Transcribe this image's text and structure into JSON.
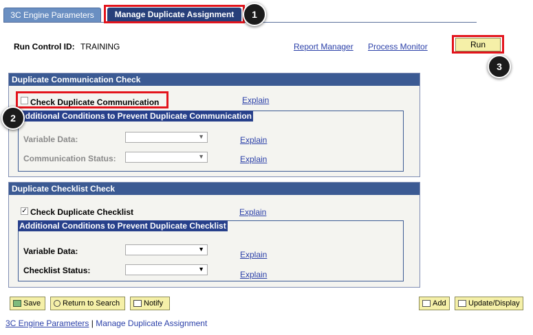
{
  "tabs": [
    {
      "label": "3C Engine Parameters"
    },
    {
      "label": "Manage Duplicate Assignment"
    }
  ],
  "callouts": [
    "1",
    "2",
    "3"
  ],
  "header": {
    "run_control_label": "Run Control ID:",
    "run_control_value": "TRAINING",
    "report_manager": "Report Manager",
    "process_monitor": "Process Monitor",
    "run_button": "Run"
  },
  "comm_group": {
    "title": "Duplicate Communication Check",
    "checkbox_label": "Check Duplicate Communication",
    "checked": false,
    "explain": "Explain",
    "inner_title": "Additional Conditions to Prevent Duplicate Communication",
    "fields": [
      {
        "label": "Variable Data:",
        "value": "",
        "explain": "Explain"
      },
      {
        "label": "Communication Status:",
        "value": "",
        "explain": "Explain"
      }
    ]
  },
  "checklist_group": {
    "title": "Duplicate Checklist Check",
    "checkbox_label": "Check Duplicate Checklist",
    "checked": true,
    "explain": "Explain",
    "inner_title": "Additional Conditions to Prevent Duplicate Checklist",
    "fields": [
      {
        "label": "Variable Data:",
        "value": "",
        "explain": "Explain"
      },
      {
        "label": "Checklist Status:",
        "value": "",
        "explain": "Explain"
      }
    ]
  },
  "toolbar": {
    "save": "Save",
    "return_to_search": "Return to Search",
    "notify": "Notify",
    "add": "Add",
    "update_display": "Update/Display"
  },
  "footer": {
    "link1": "3C Engine Parameters",
    "separator": "|",
    "link2": "Manage Duplicate Assignment"
  },
  "colors": {
    "annotation_red": "#e3141c",
    "header_blue": "#3b5a93",
    "button_yellow": "#f5f0a8"
  }
}
